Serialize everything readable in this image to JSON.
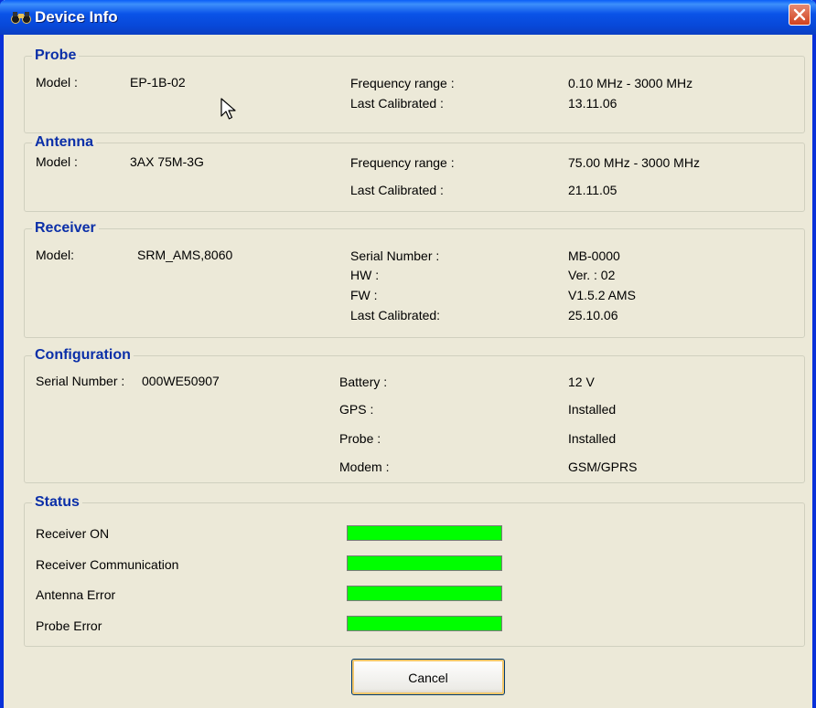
{
  "window": {
    "title": "Device Info"
  },
  "probe": {
    "legend": "Probe",
    "model_label": "Model :",
    "model_value": "EP-1B-02",
    "freq_label": "Frequency range :",
    "freq_value": "0.10 MHz -  3000 MHz",
    "cal_label": "Last Calibrated :",
    "cal_value": "13.11.06"
  },
  "antenna": {
    "legend": "Antenna",
    "model_label": "Model :",
    "model_value": "3AX 75M-3G",
    "freq_label": "Frequency range :",
    "freq_value": "75.00 MHz -  3000 MHz",
    "cal_label": "Last Calibrated :",
    "cal_value": "21.11.05"
  },
  "receiver": {
    "legend": "Receiver",
    "model_label": "Model:",
    "model_value": "SRM_AMS,8060",
    "serial_label": "Serial Number :",
    "serial_value": "MB-0000",
    "hw_label": "HW :",
    "hw_value": "Ver. : 02",
    "fw_label": "FW :",
    "fw_value": "V1.5.2 AMS",
    "cal_label": "Last Calibrated:",
    "cal_value": "25.10.06"
  },
  "configuration": {
    "legend": "Configuration",
    "serial_label": "Serial Number :",
    "serial_value": "000WE50907",
    "battery_label": "Battery :",
    "battery_value": "12 V",
    "gps_label": "GPS :",
    "gps_value": "Installed",
    "probe_label": "Probe :",
    "probe_value": "Installed",
    "modem_label": "Modem :",
    "modem_value": "GSM/GPRS"
  },
  "status": {
    "legend": "Status",
    "items": [
      {
        "label": "Receiver ON",
        "indicator_color": "#00ff00"
      },
      {
        "label": "Receiver Communication",
        "indicator_color": "#00ff00"
      },
      {
        "label": "Antenna Error",
        "indicator_color": "#00ff00"
      },
      {
        "label": "Probe Error",
        "indicator_color": "#00ff00"
      }
    ]
  },
  "buttons": {
    "cancel": "Cancel"
  },
  "icons": {
    "title_icon": "binoculars-icon",
    "close": "close-icon",
    "cursor": "mouse-cursor-icon"
  },
  "colors": {
    "title_bar": "#0a53e8",
    "legend_text": "#0b2fa8",
    "status_ok": "#00ff00",
    "background": "#ece9d8"
  }
}
